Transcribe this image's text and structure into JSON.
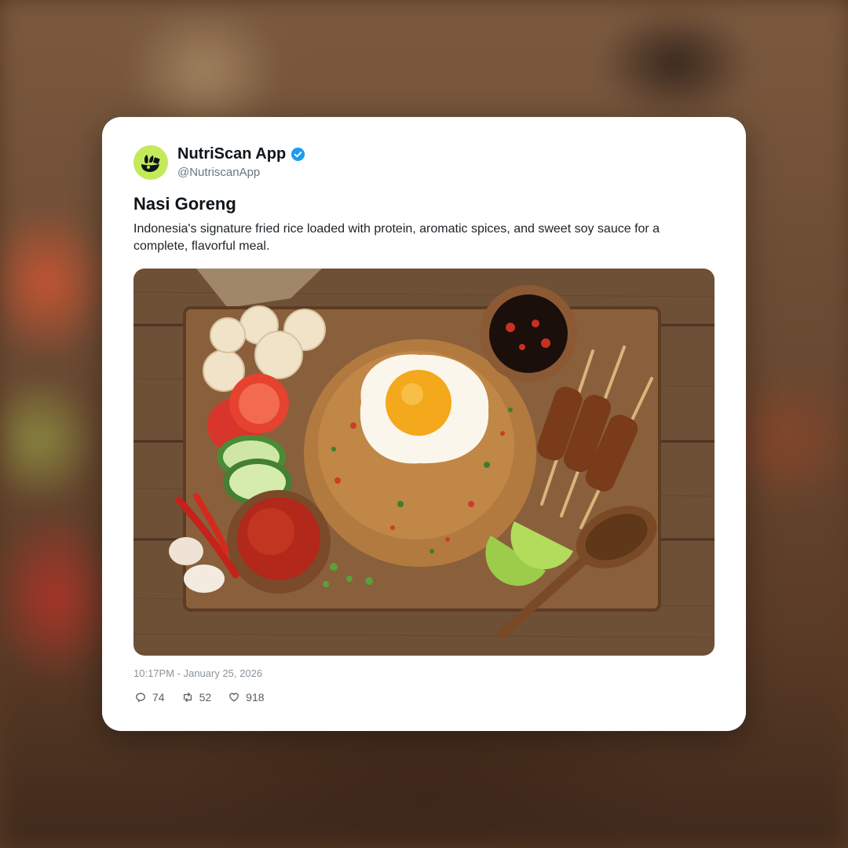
{
  "post": {
    "author_name": "NutriScan App",
    "handle": "@NutriscanApp",
    "verified": true,
    "title": "Nasi Goreng",
    "description": "Indonesia's signature fried rice loaded with protein, aromatic spices, and sweet soy sauce for a complete, flavorful meal.",
    "timestamp": "10:17PM - January 25, 2026",
    "stats": {
      "replies": "74",
      "reposts": "52",
      "likes": "918"
    }
  },
  "icons": {
    "avatar": "leaf-logo-icon",
    "verified": "verified-badge-icon",
    "reply": "comment-icon",
    "repost": "repost-icon",
    "like": "heart-icon"
  },
  "colors": {
    "avatar_bg": "#c3ea5a",
    "verified_blue": "#1d9bf0",
    "card_bg": "#ffffff"
  }
}
